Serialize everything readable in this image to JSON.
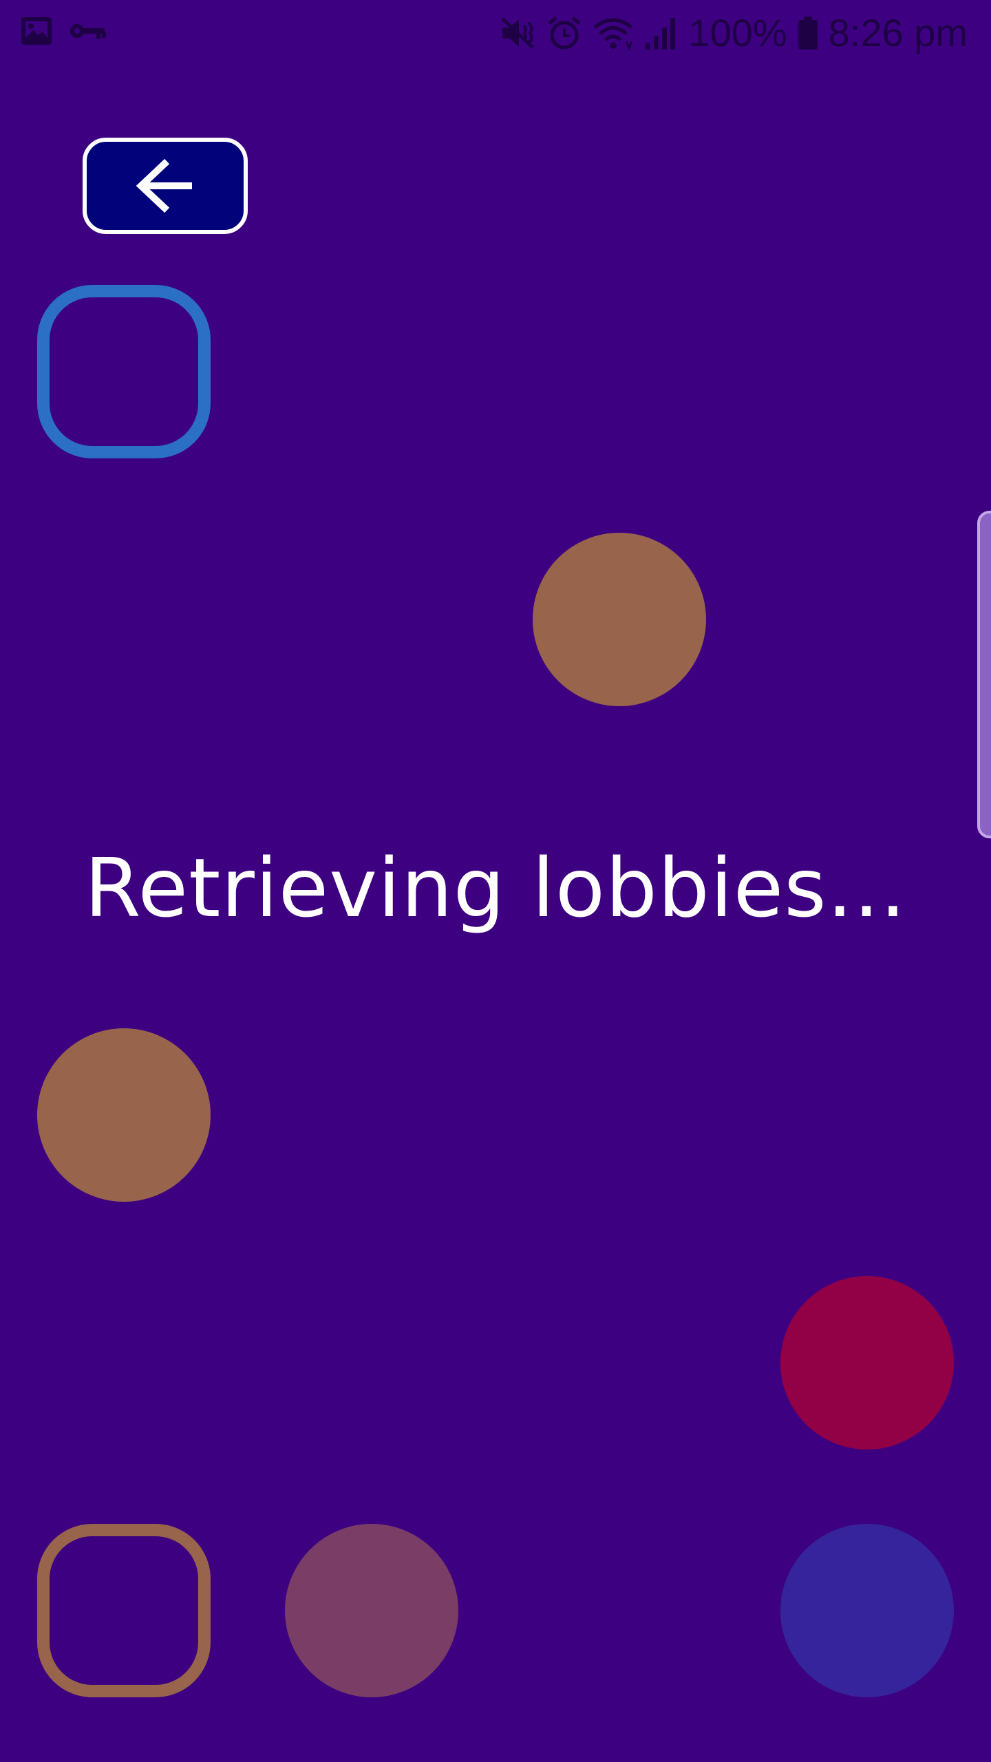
{
  "status_bar": {
    "battery_percent": "100%",
    "time": "8:26 pm",
    "icons": [
      "image-icon",
      "key-icon",
      "mute-icon",
      "alarm-icon",
      "wifi-icon",
      "signal-icon",
      "battery-icon"
    ]
  },
  "back_button": {
    "icon": "arrow-left-icon"
  },
  "loading": {
    "message": "Retrieving lobbies..."
  },
  "colors": {
    "background": "#3d0081",
    "back_button_fill": "#02037a",
    "back_button_border": "#ffffff",
    "blue_outline": "#2c70c6",
    "brown": "#98644b",
    "crimson": "#920045",
    "mauve": "#7a3e66",
    "indigo": "#36249d"
  },
  "decorations": [
    {
      "shape": "rounded-square-outline",
      "color": "blue"
    },
    {
      "shape": "circle",
      "color": "brown"
    },
    {
      "shape": "circle",
      "color": "brown"
    },
    {
      "shape": "circle",
      "color": "crimson"
    },
    {
      "shape": "rounded-square-outline",
      "color": "brown"
    },
    {
      "shape": "circle",
      "color": "mauve"
    },
    {
      "shape": "circle",
      "color": "indigo"
    }
  ]
}
